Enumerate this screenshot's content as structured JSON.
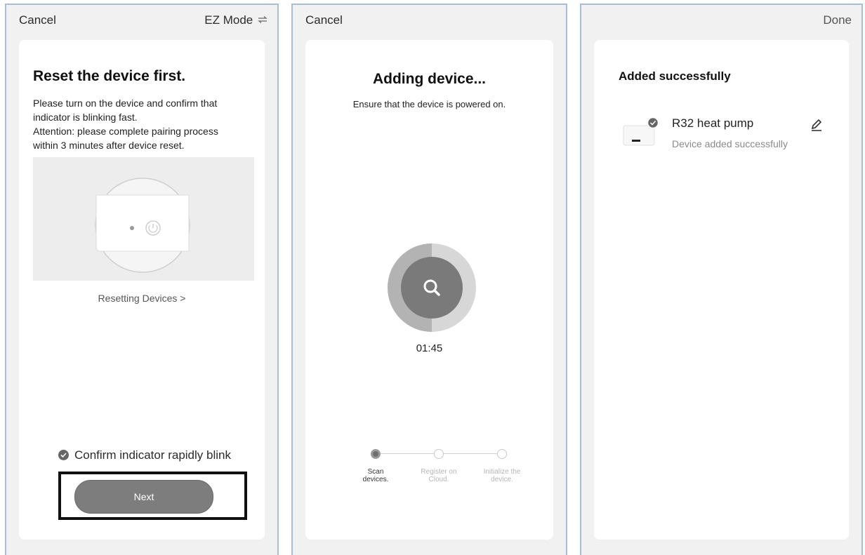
{
  "screen1": {
    "cancel": "Cancel",
    "mode": "EZ Mode",
    "mode_icon": "swap-arrows-icon",
    "title": "Reset the device first.",
    "desc": [
      "Please turn on the device and confirm that",
      "indicator is blinking fast.",
      "Attention: please complete pairing process",
      "within 3 minutes after device reset."
    ],
    "reset_link": "Resetting Devices >",
    "confirm": "Confirm indicator rapidly blink",
    "next": "Next"
  },
  "screen2": {
    "cancel": "Cancel",
    "title": "Adding device...",
    "subtitle": "Ensure that the device is powered on.",
    "timer": "01:45",
    "steps": [
      {
        "line1": "Scan",
        "line2": "devices.",
        "active": true
      },
      {
        "line1": "Register on",
        "line2": "Cloud.",
        "active": false
      },
      {
        "line1": "Initialize the",
        "line2": "device.",
        "active": false
      }
    ]
  },
  "screen3": {
    "done": "Done",
    "title": "Added successfully",
    "device_name": "R32 heat pump",
    "device_status": "Device added successfully",
    "edit_icon": "pencil-icon"
  },
  "colors": {
    "background": "#f1f1f1",
    "card": "#ffffff",
    "button": "#7d7d7d",
    "screen_border": "#a9bdd6",
    "highlight_border": "#111111"
  }
}
